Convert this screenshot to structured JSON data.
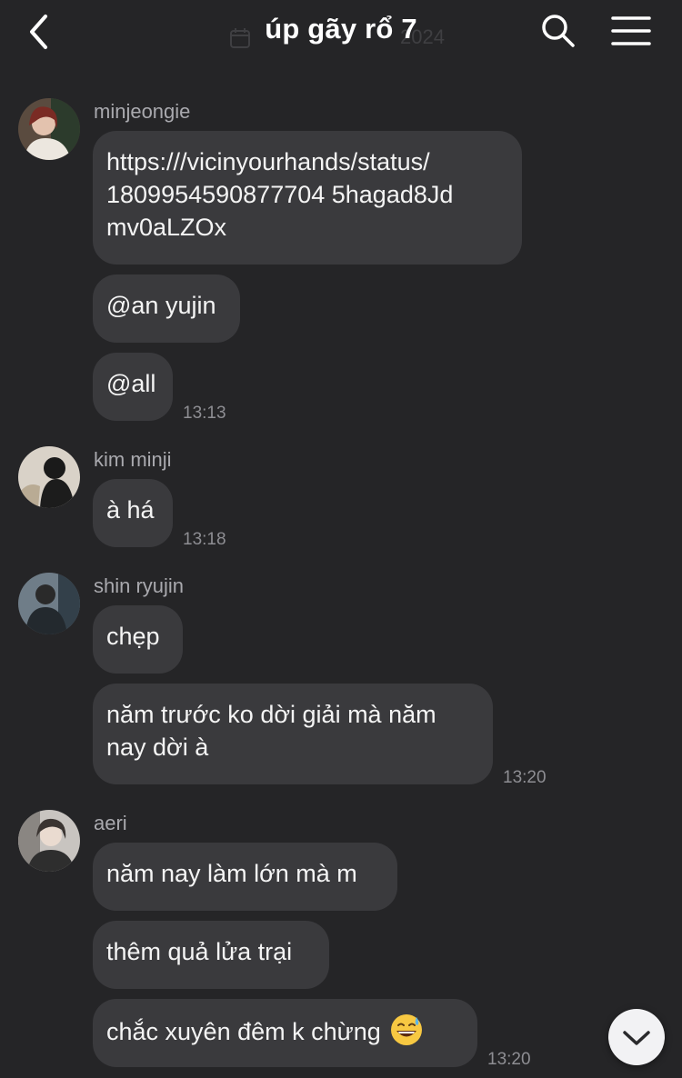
{
  "header": {
    "title": "úp gãy rổ 7",
    "faint_date_suffix": "2024"
  },
  "messages": [
    {
      "sender": "minjeongie",
      "bubbles": [
        "https:///vicinyourhands/status/\n1809954590877704 5hagad8Jd\nmv0aLZOx",
        "@an yujin",
        "@all"
      ],
      "time": "13:13"
    },
    {
      "sender": "kim minji",
      "bubbles": [
        "à há"
      ],
      "time": "13:18"
    },
    {
      "sender": "shin ryujin",
      "bubbles": [
        "chẹp",
        "năm trước ko dời giải mà năm\nnay dời à"
      ],
      "time": "13:20"
    },
    {
      "sender": "aeri",
      "bubbles": [
        "năm nay làm lớn mà m",
        "thêm quả lửa trại",
        "chắc xuyên đêm k chừng"
      ],
      "time": "13:20"
    }
  ],
  "icons": {
    "back": "chevron-left-icon",
    "search": "search-icon",
    "menu": "hamburger-menu-icon",
    "scroll": "chevron-down-icon",
    "emoji": "grinning-sweat-emoji"
  },
  "colors": {
    "background": "#252527",
    "bubble": "#3a3a3d",
    "meta_text": "#8e8e93"
  }
}
